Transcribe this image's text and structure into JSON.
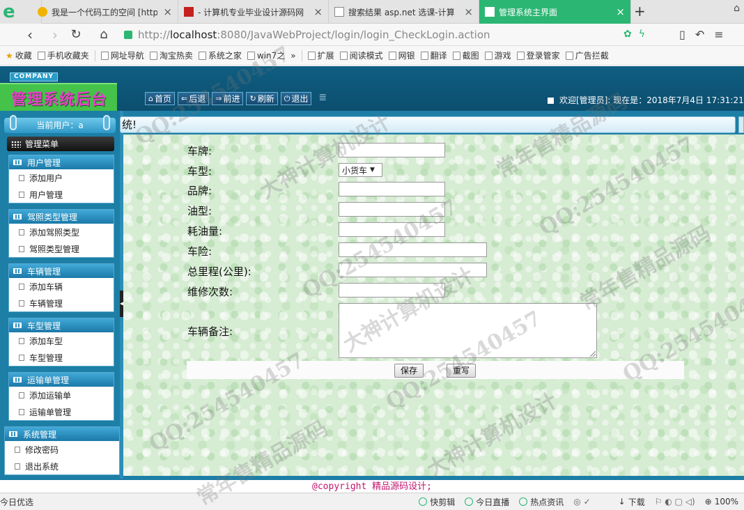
{
  "browser": {
    "tabs": [
      {
        "title": "我是一个代码工的空间 [http:",
        "close": "×"
      },
      {
        "title": "- 计算机专业毕业设计源码网",
        "close": "×"
      },
      {
        "title": "搜索结果 asp.net 选课-计算",
        "close": "×"
      },
      {
        "title": "管理系统主界面",
        "close": "×"
      }
    ],
    "new_tab": "+",
    "url_prefix": "http://",
    "url_host": "localhost",
    "url_path": ":8080/JavaWebProject/login/login_CheckLogin.action",
    "bookmarks": [
      "收藏",
      "手机收藏夹",
      "网址导航",
      "淘宝热卖",
      "系统之家",
      "win7之",
      "»",
      "扩展",
      "阅读模式",
      "网银",
      "翻译",
      "截图",
      "游戏",
      "登录管家",
      "广告拦截"
    ],
    "status_left": "今日优选",
    "status_items": [
      "快剪辑",
      "今日直播",
      "热点资讯",
      "下载",
      "100%"
    ]
  },
  "app": {
    "company_badge": "COMPANY",
    "logo_title": "管理系统后台",
    "top_buttons": [
      "首页",
      "后退",
      "前进",
      "刷新",
      "退出"
    ],
    "welcome": "欢迎[管理员]:   现在是：2018年7月4日  17:31:21",
    "current_user": "当前用户：a",
    "manage_menu": "管理菜单",
    "menu_groups": [
      {
        "title": "用户管理",
        "items": [
          "添加用户",
          "用户管理"
        ]
      },
      {
        "title": "驾照类型管理",
        "items": [
          "添加驾照类型",
          "驾照类型管理"
        ]
      },
      {
        "title": "车辆管理",
        "items": [
          "添加车辆",
          "车辆管理"
        ]
      },
      {
        "title": "车型管理",
        "items": [
          "添加车型",
          "车型管理"
        ]
      },
      {
        "title": "运输单管理",
        "items": [
          "添加运输单",
          "运输单管理"
        ]
      },
      {
        "title": "系统管理",
        "items": [
          "修改密码",
          "退出系统"
        ]
      }
    ],
    "main_bar_text": "统!",
    "form": {
      "labels": [
        "车牌:",
        "车型:",
        "品牌:",
        "油型:",
        "耗油量:",
        "车险:",
        "总里程(公里):",
        "维修次数:",
        "车辆备注:"
      ],
      "car_type_selected": "小货车",
      "save_label": "保存",
      "reset_label": "重写"
    },
    "footer": "@copyright 精品源码设计;"
  },
  "watermarks": [
    "QQ:254540457",
    "大神计算机设计",
    "常年售精品源码"
  ]
}
